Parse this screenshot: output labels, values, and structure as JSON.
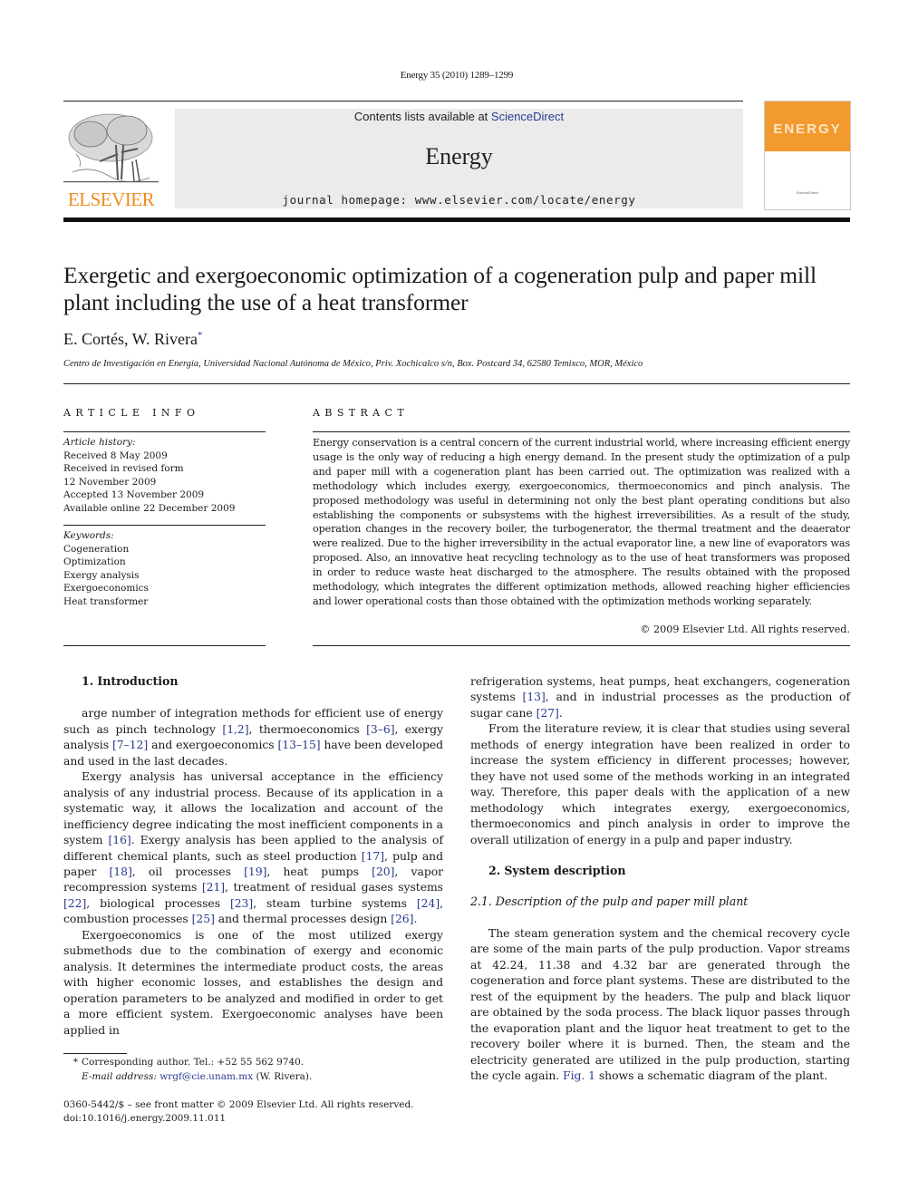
{
  "journal_ref": "Energy 35 (2010) 1289–1299",
  "banner": {
    "contents_prefix": "Contents lists available at ",
    "contents_link": "ScienceDirect",
    "journal_name": "Energy",
    "homepage": "journal homepage: www.elsevier.com/locate/energy"
  },
  "publisher_logo": {
    "icon": "elsevier-tree-icon",
    "wordmark": "ELSEVIER",
    "color": "#f28c1f"
  },
  "cover": {
    "title": "ENERGY",
    "color": "#f39a2e",
    "footer": "ScienceDirect"
  },
  "article": {
    "title": "Exergetic and exergoeconomic optimization of a cogeneration pulp and paper mill plant including the use of a heat transformer",
    "authors": "E. Cortés, W. Rivera",
    "author_mark": "*",
    "affiliation": "Centro de Investigación en Energía, Universidad Nacional Autónoma de México, Priv. Xochicalco s/n, Box. Postcard 34, 62580 Temixco, MOR, México"
  },
  "article_info": {
    "heading": "ARTICLE INFO",
    "history_label": "Article history:",
    "history": [
      "Received 8 May 2009",
      "Received in revised form",
      "12 November 2009",
      "Accepted 13 November 2009",
      "Available online 22 December 2009"
    ],
    "keywords_label": "Keywords:",
    "keywords": [
      "Cogeneration",
      "Optimization",
      "Exergy analysis",
      "Exergoeconomics",
      "Heat transformer"
    ]
  },
  "abstract": {
    "heading": "ABSTRACT",
    "text": "Energy conservation is a central concern of the current industrial world, where increasing efficient energy usage is the only way of reducing a high energy demand. In the present study the optimization of a pulp and paper mill with a cogeneration plant has been carried out. The optimization was realized with a methodology which includes exergy, exergoeconomics, thermoeconomics and pinch analysis. The proposed methodology was useful in determining not only the best plant operating conditions but also establishing the components or subsystems with the highest irreversibilities. As a result of the study, operation changes in the recovery boiler, the turbogenerator, the thermal treatment and the deaerator were realized. Due to the higher irreversibility in the actual evaporator line, a new line of evaporators was proposed. Also, an innovative heat recycling technology as to the use of heat transformers was proposed in order to reduce waste heat discharged to the atmosphere. The results obtained with the proposed methodology, which integrates the different optimization methods, allowed reaching higher efficiencies and lower operational costs than those obtained with the optimization methods working separately.",
    "copyright": "© 2009 Elsevier Ltd. All rights reserved."
  },
  "body": {
    "sec1_heading": "1.  Introduction",
    "p1": [
      {
        "t": "arge number of integration methods for efficient use of energy such as pinch technology "
      },
      {
        "t": "[1,2]",
        "ref": true
      },
      {
        "t": ", thermoeconomics "
      },
      {
        "t": "[3–6]",
        "ref": true
      },
      {
        "t": ", exergy analysis "
      },
      {
        "t": "[7–12]",
        "ref": true
      },
      {
        "t": " and exergoeconomics "
      },
      {
        "t": "[13–15]",
        "ref": true
      },
      {
        "t": " have been developed and used in the last decades."
      }
    ],
    "p2": [
      {
        "t": "Exergy analysis has universal acceptance in the efficiency analysis of any industrial process. Because of its application in a systematic way, it allows the localization and account of the inefficiency degree indicating the most inefficient components in a system "
      },
      {
        "t": "[16]",
        "ref": true
      },
      {
        "t": ". Exergy analysis has been applied to the analysis of different chemical plants, such as steel production "
      },
      {
        "t": "[17]",
        "ref": true
      },
      {
        "t": ", pulp and paper "
      },
      {
        "t": "[18]",
        "ref": true
      },
      {
        "t": ", oil processes "
      },
      {
        "t": "[19]",
        "ref": true
      },
      {
        "t": ", heat pumps "
      },
      {
        "t": "[20]",
        "ref": true
      },
      {
        "t": ", vapor recompression systems "
      },
      {
        "t": "[21]",
        "ref": true
      },
      {
        "t": ", treatment of residual gases systems "
      },
      {
        "t": "[22]",
        "ref": true
      },
      {
        "t": ", biological processes "
      },
      {
        "t": "[23]",
        "ref": true
      },
      {
        "t": ", steam turbine systems "
      },
      {
        "t": "[24]",
        "ref": true
      },
      {
        "t": ", combustion processes "
      },
      {
        "t": "[25]",
        "ref": true
      },
      {
        "t": " and thermal processes design "
      },
      {
        "t": "[26]",
        "ref": true
      },
      {
        "t": "."
      }
    ],
    "p3": [
      {
        "t": "Exergoeconomics is one of the most utilized exergy submethods due to the combination of exergy and economic analysis. It determines the intermediate product costs, the areas with higher economic losses, and establishes the design and operation parameters to be analyzed and modified in order to get a more efficient system. Exergoeconomic analyses have been applied in refrigeration systems, heat pumps, heat exchangers, cogeneration systems "
      },
      {
        "t": "[13]",
        "ref": true
      },
      {
        "t": ", and in industrial processes as the production of sugar cane "
      },
      {
        "t": "[27]",
        "ref": true
      },
      {
        "t": "."
      }
    ],
    "p4": [
      {
        "t": "From the literature review, it is clear that studies using several methods of energy integration have been realized in order to increase the system efficiency in different processes; however, they have not used some of the methods working in an integrated way. Therefore, this paper deals with the application of a new methodology which integrates exergy, exergoeconomics, thermoeconomics and pinch analysis in order to improve the overall utilization of energy in a pulp and paper industry."
      }
    ],
    "sec2_heading": "2.  System description",
    "sec21_heading": "2.1.  Description of the pulp and paper mill plant",
    "p5": [
      {
        "t": "The steam generation system and the chemical recovery cycle are some of the main parts of the pulp production. Vapor streams at 42.24, 11.38 and 4.32 bar are generated through the cogeneration and force plant systems. These are distributed to the rest of the equipment by the headers. The pulp and black liquor are obtained by the soda process. The black liquor passes through the evaporation plant and the liquor heat treatment to get to the recovery boiler where it is burned. Then, the steam and the electricity generated are utilized in the pulp production, starting the cycle again. "
      },
      {
        "t": "Fig. 1",
        "ref": true
      },
      {
        "t": " shows a schematic diagram of the plant."
      }
    ]
  },
  "footnotes": {
    "star": "*",
    "corresponding": "Corresponding author. Tel.: +52 55 562 9740.",
    "email_label": "E-mail address:",
    "email": "wrgf@cie.unam.mx",
    "email_suffix": " (W. Rivera).",
    "issn": "0360-5442/$ – see front matter © 2009 Elsevier Ltd. All rights reserved.",
    "doi": "doi:10.1016/j.energy.2009.11.011"
  }
}
